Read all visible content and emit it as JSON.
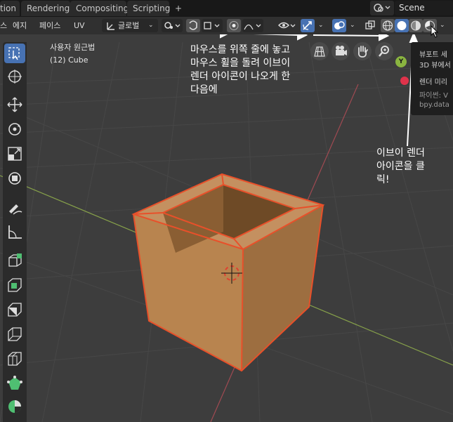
{
  "tabs": [
    "tion",
    "Rendering",
    "Compositing",
    "Scripting",
    "+"
  ],
  "scene": {
    "icon": "scene-icon",
    "name": "Scene"
  },
  "header": {
    "menu_items": [
      "스",
      "에지",
      "페이스",
      "UV"
    ],
    "orientation": "글로벌"
  },
  "viewport": {
    "view_name": "사용자 원근법",
    "object_name": "(12) Cube",
    "gizmo_axis": "Y"
  },
  "popup": {
    "title": "뷰포트 세",
    "subtitle": "3D 뷰에서",
    "render_preview": "렌더 미리",
    "python_label": "파이썬: V",
    "python_path": "bpy.data"
  },
  "annotations": {
    "instruction_1": [
      "마우스를 위쪽 줄에 놓고",
      "마우스 휠을 돌려 이브이",
      "렌더 아이콘이 나오게 한",
      "다음에"
    ],
    "instruction_2": [
      "이브이 렌더",
      "아이콘을 클",
      "릭!"
    ]
  },
  "colors": {
    "selection_outline": "#e8502a",
    "cube": "#b8844f",
    "active_tool": "#4772b3"
  }
}
